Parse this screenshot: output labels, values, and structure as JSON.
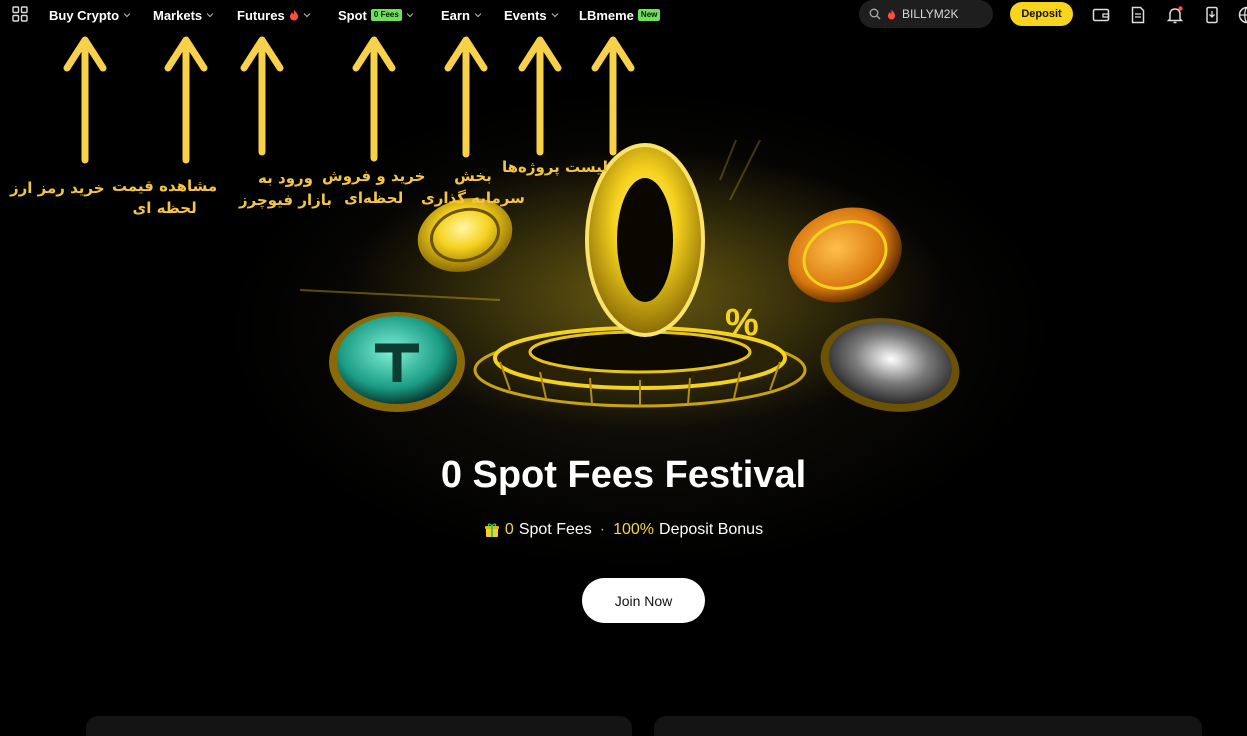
{
  "nav": {
    "items": [
      {
        "label": "Buy Crypto"
      },
      {
        "label": "Markets"
      },
      {
        "label": "Futures"
      },
      {
        "label": "Spot",
        "badge": "0 Fees"
      },
      {
        "label": "Earn"
      },
      {
        "label": "Events"
      },
      {
        "label": "LBmeme",
        "badge": "New"
      }
    ],
    "search_value": "BILLYM2K",
    "deposit_label": "Deposit"
  },
  "annotations": [
    "خرید رمز ارز",
    "مشاهده قیمت لحظه ای",
    "ورود به بازار فیوچرز",
    "خرید و فروش لحظه‌ای",
    "بخش سرمایه گذاری",
    "لیست پروژه‌ها"
  ],
  "annotation_lines": {
    "markets_1": "مشاهده قیمت",
    "markets_2": "لحظه ای",
    "futures_1": "ورود به",
    "futures_2": "بازار فیوچرز",
    "spot_1": "خرید و فروش",
    "spot_2": "لحظه‌ای",
    "earn_1": "بخش",
    "earn_2": "سرمایه گذاری"
  },
  "hero": {
    "big_digit": "0",
    "percent": "%",
    "title": "0 Spot Fees Festival",
    "sub_hl1": "0",
    "sub_text1": "Spot Fees",
    "sub_sep": "·",
    "sub_hl2": "100%",
    "sub_text2": "Deposit Bonus",
    "cta": "Join Now"
  },
  "colors": {
    "accent_yellow": "#f7d51d",
    "annotation": "#f4c542",
    "badge_green": "#6ee05a"
  }
}
